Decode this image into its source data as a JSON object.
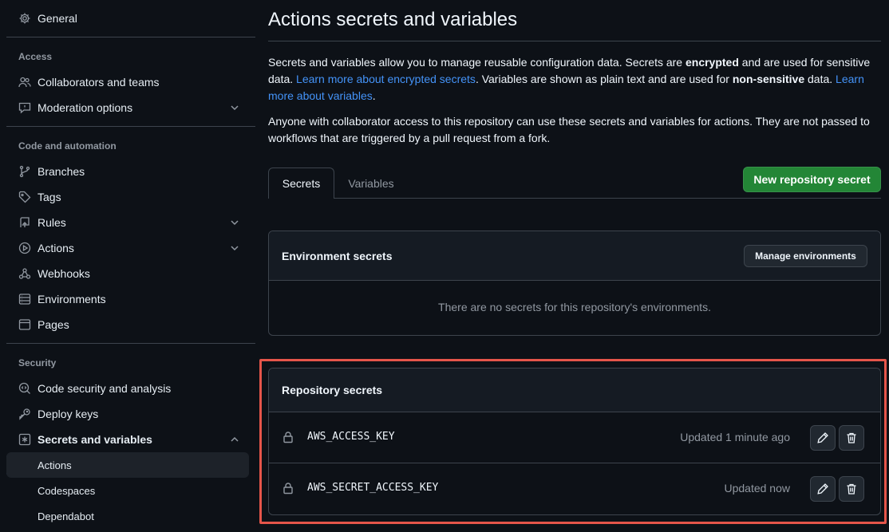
{
  "sidebar": {
    "general": {
      "label": "General",
      "icon": "gear-icon"
    },
    "sections": {
      "access": "Access",
      "code_automation": "Code and automation",
      "security": "Security"
    },
    "access_items": [
      {
        "label": "Collaborators and teams",
        "icon": "people-icon"
      },
      {
        "label": "Moderation options",
        "icon": "report-icon",
        "expandable": true
      }
    ],
    "code_items": [
      {
        "label": "Branches",
        "icon": "git-branch-icon"
      },
      {
        "label": "Tags",
        "icon": "tag-icon"
      },
      {
        "label": "Rules",
        "icon": "repo-push-icon",
        "expandable": true
      },
      {
        "label": "Actions",
        "icon": "play-icon",
        "expandable": true
      },
      {
        "label": "Webhooks",
        "icon": "webhook-icon"
      },
      {
        "label": "Environments",
        "icon": "server-icon"
      },
      {
        "label": "Pages",
        "icon": "browser-icon"
      }
    ],
    "security_items": [
      {
        "label": "Code security and analysis",
        "icon": "codescan-icon"
      },
      {
        "label": "Deploy keys",
        "icon": "key-icon"
      },
      {
        "label": "Secrets and variables",
        "icon": "key-asterisk-icon",
        "expanded": true
      }
    ],
    "secrets_sub_items": [
      {
        "label": "Actions",
        "active": true
      },
      {
        "label": "Codespaces"
      },
      {
        "label": "Dependabot"
      }
    ]
  },
  "main": {
    "title": "Actions secrets and variables",
    "intro": {
      "t1": "Secrets and variables allow you to manage reusable configuration data. Secrets are ",
      "b1": "encrypted",
      "t2": " and are used for sensitive data. ",
      "link1": "Learn more about encrypted secrets",
      "t3": ". Variables are shown as plain text and are used for ",
      "b2": "non-sensitive",
      "t4": " data. ",
      "link2": "Learn more about variables",
      "t5": "."
    },
    "access_note": "Anyone with collaborator access to this repository can use these secrets and variables for actions. They are not passed to workflows that are triggered by a pull request from a fork.",
    "tabs": [
      {
        "label": "Secrets",
        "selected": true
      },
      {
        "label": "Variables",
        "selected": false
      }
    ],
    "new_secret_button": "New repository secret",
    "environment_secrets": {
      "title": "Environment secrets",
      "manage_button": "Manage environments",
      "empty_message": "There are no secrets for this repository's environments."
    },
    "repository_secrets": {
      "title": "Repository secrets",
      "rows": [
        {
          "name": "AWS_ACCESS_KEY",
          "updated": "Updated 1 minute ago"
        },
        {
          "name": "AWS_SECRET_ACCESS_KEY",
          "updated": "Updated now"
        }
      ]
    }
  },
  "colors": {
    "background": "#0d1117",
    "accent_link": "#4493f8",
    "primary_button": "#238636",
    "highlight_outline": "#e5554a"
  }
}
